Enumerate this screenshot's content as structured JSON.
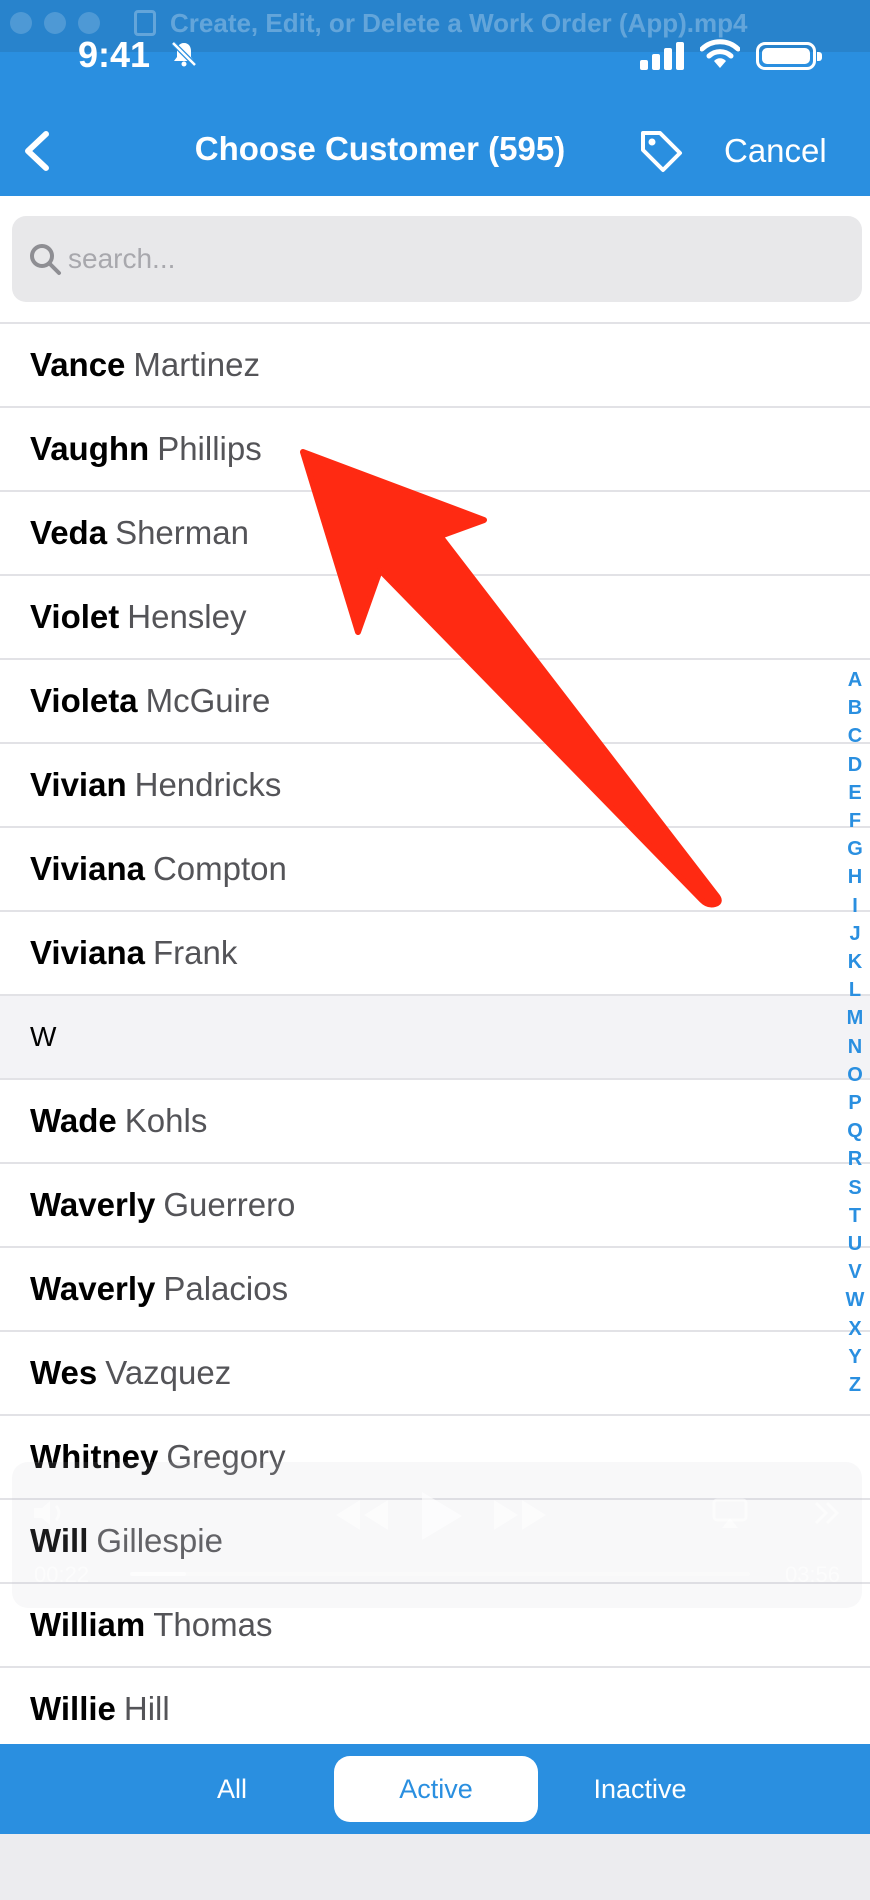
{
  "window": {
    "title": "Create, Edit, or Delete a Work Order (App).mp4"
  },
  "status_bar": {
    "time": "9:41"
  },
  "nav": {
    "title": "Choose Customer (595)",
    "cancel_label": "Cancel"
  },
  "search": {
    "placeholder": "search..."
  },
  "list": [
    {
      "type": "customer",
      "first": "Vance",
      "last": "Martinez"
    },
    {
      "type": "customer",
      "first": "Vaughn",
      "last": "Phillips"
    },
    {
      "type": "customer",
      "first": "Veda",
      "last": "Sherman"
    },
    {
      "type": "customer",
      "first": "Violet",
      "last": "Hensley"
    },
    {
      "type": "customer",
      "first": "Violeta",
      "last": "McGuire"
    },
    {
      "type": "customer",
      "first": "Vivian",
      "last": "Hendricks"
    },
    {
      "type": "customer",
      "first": "Viviana",
      "last": "Compton"
    },
    {
      "type": "customer",
      "first": "Viviana",
      "last": "Frank"
    },
    {
      "type": "section",
      "label": "W"
    },
    {
      "type": "customer",
      "first": "Wade",
      "last": "Kohls"
    },
    {
      "type": "customer",
      "first": "Waverly",
      "last": "Guerrero"
    },
    {
      "type": "customer",
      "first": "Waverly",
      "last": "Palacios"
    },
    {
      "type": "customer",
      "first": "Wes",
      "last": "Vazquez"
    },
    {
      "type": "customer",
      "first": "Whitney",
      "last": "Gregory"
    },
    {
      "type": "customer",
      "first": "Will",
      "last": "Gillespie"
    },
    {
      "type": "customer",
      "first": "William",
      "last": "Thomas"
    },
    {
      "type": "customer",
      "first": "Willie",
      "last": "Hill"
    }
  ],
  "alpha_index": [
    "A",
    "B",
    "C",
    "D",
    "E",
    "F",
    "G",
    "H",
    "I",
    "J",
    "K",
    "L",
    "M",
    "N",
    "O",
    "P",
    "Q",
    "R",
    "S",
    "T",
    "U",
    "V",
    "W",
    "X",
    "Y",
    "Z"
  ],
  "video_overlay": {
    "elapsed": "00:22",
    "remaining": "03:56"
  },
  "filters": [
    {
      "label": "All",
      "active": false
    },
    {
      "label": "Active",
      "active": true
    },
    {
      "label": "Inactive",
      "active": false
    }
  ],
  "colors": {
    "accent": "#2a8fe0",
    "annotation": "#ff2a12"
  }
}
